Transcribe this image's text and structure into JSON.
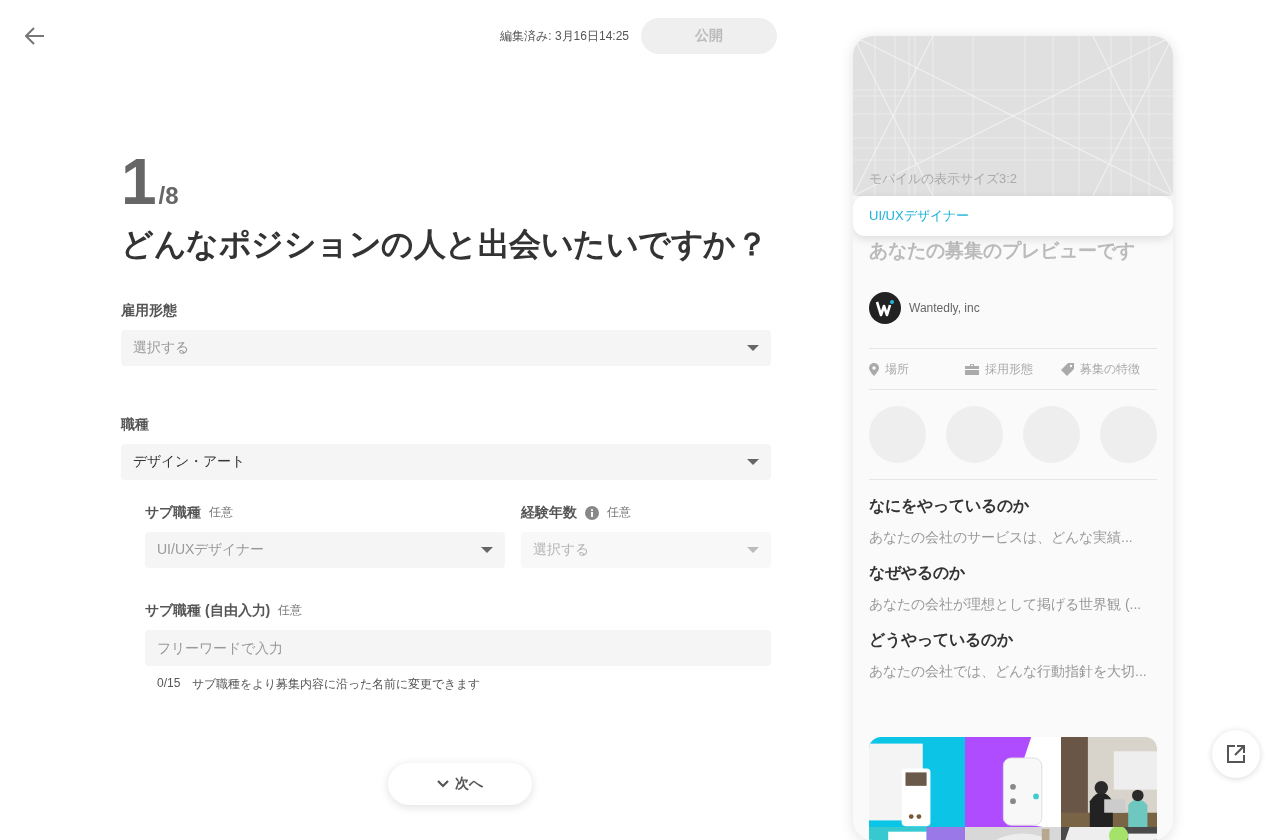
{
  "topbar": {
    "edited": "編集済み: 3月16日14:25",
    "publish": {
      "label": "公開",
      "disabled": true
    }
  },
  "step": {
    "current": "1",
    "total": "/8"
  },
  "question": "どんなポジションの人と出会いたいですか？",
  "fields": [
    {
      "label": "雇用形態",
      "control": {
        "kind": "select",
        "placeholder": "選択する",
        "disabled": false
      }
    },
    {
      "label": "職種",
      "control": {
        "kind": "select",
        "value": "デザイン・アート",
        "disabled": false
      }
    }
  ],
  "sub_fields": [
    {
      "label": "サブ職種",
      "optional": "任意",
      "info": false,
      "control": {
        "kind": "select",
        "placeholder": "UI/UXデザイナー",
        "disabled": false
      }
    },
    {
      "label": "経験年数",
      "optional": "任意",
      "info": true,
      "control": {
        "kind": "select",
        "placeholder": "選択する",
        "disabled": true
      }
    }
  ],
  "free_input": {
    "label": "サブ職種 (自由入力)",
    "optional": "任意",
    "control": {
      "kind": "text",
      "placeholder": "フリーワードで入力"
    },
    "counter": "0/15",
    "hint": "サブ職種をより募集内容に沿った名前に変更できます"
  },
  "next_button": "次へ",
  "preview": {
    "hero_caption": "モバイルの表示サイズ3:2",
    "position": "UI/UXデザイナー",
    "title": "あなたの募集のプレビューです",
    "company": "Wantedly, inc",
    "meta": [
      {
        "kind": "location",
        "label": "場所"
      },
      {
        "kind": "briefcase",
        "label": "採用形態"
      },
      {
        "kind": "tag",
        "label": "募集の特徴"
      }
    ],
    "sections": [
      {
        "heading": "なにをやっているのか",
        "text": "あなたの会社のサービスは、どんな実績..."
      },
      {
        "heading": "なぜやるのか",
        "text": "あなたの会社が理想として掲げる世界観 (..."
      },
      {
        "heading": "どうやっているのか",
        "text": "あなたの会社では、どんな行動指針を大切..."
      }
    ]
  }
}
